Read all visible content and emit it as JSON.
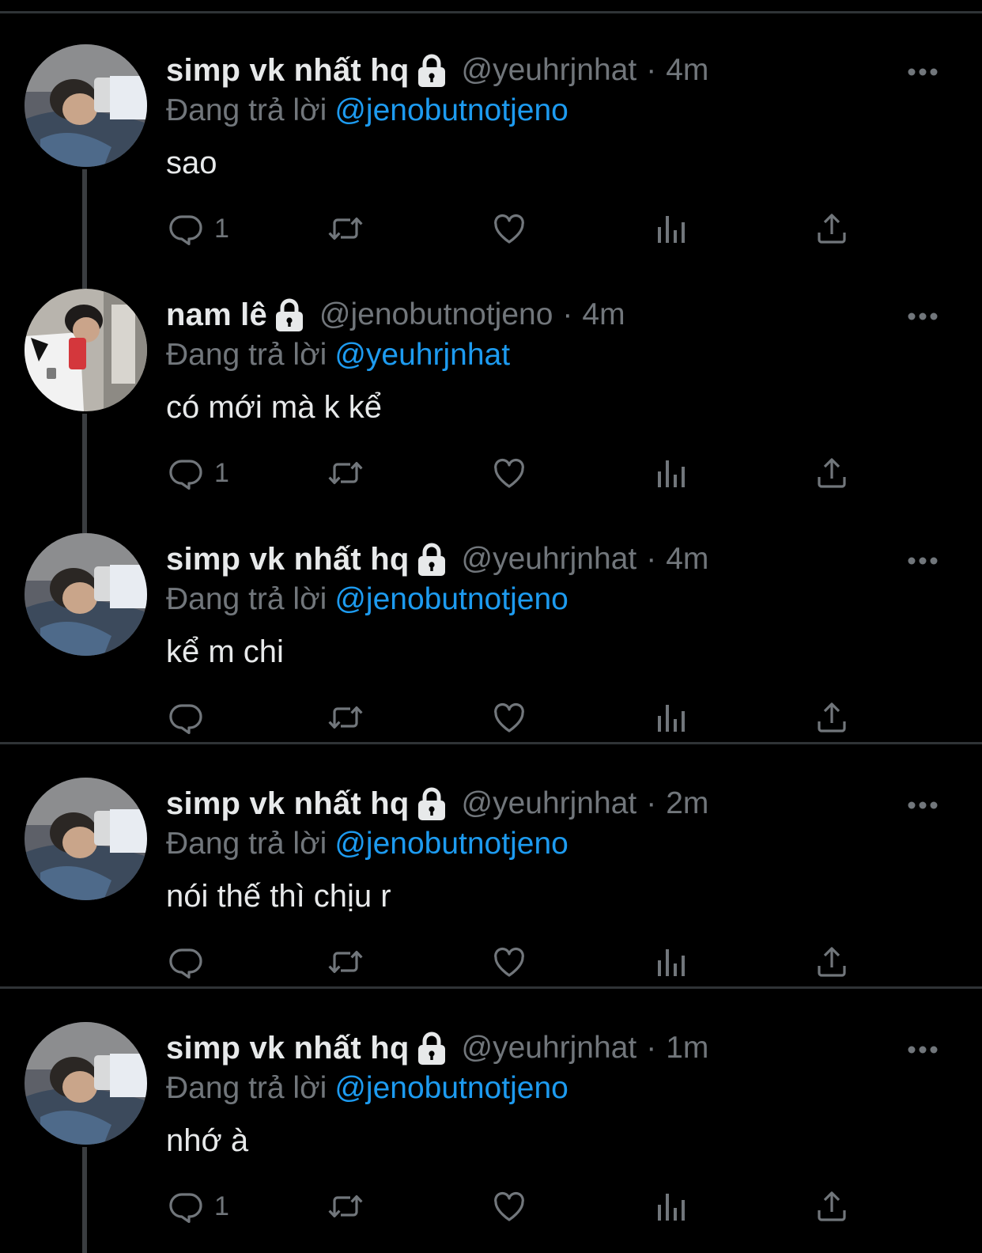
{
  "replying_prefix": "Đang trả lời",
  "dot": "·",
  "tweets": [
    {
      "name": "simp vk nhất hq",
      "handle": "@yeuhrjnhat",
      "time": "4m",
      "replying_to": "@jenobutnotjeno",
      "text": "sao",
      "reply_count": "1"
    },
    {
      "name": "nam lê",
      "handle": "@jenobutnotjeno",
      "time": "4m",
      "replying_to": "@yeuhrjnhat",
      "text": "có mới mà k kể",
      "reply_count": "1"
    },
    {
      "name": "simp vk nhất hq",
      "handle": "@yeuhrjnhat",
      "time": "4m",
      "replying_to": "@jenobutnotjeno",
      "text": "kể m chi",
      "reply_count": ""
    },
    {
      "name": "simp vk nhất hq",
      "handle": "@yeuhrjnhat",
      "time": "2m",
      "replying_to": "@jenobutnotjeno",
      "text": "nói thế thì chịu r",
      "reply_count": ""
    },
    {
      "name": "simp vk nhất hq",
      "handle": "@yeuhrjnhat",
      "time": "1m",
      "replying_to": "@jenobutnotjeno",
      "text": "nhớ à",
      "reply_count": "1"
    }
  ],
  "colors": {
    "background": "#000000",
    "primary_text": "#e7e9ea",
    "secondary_text": "#71767b",
    "mention": "#1d9bf0",
    "divider": "#2f3336"
  },
  "icons": [
    "lock-icon",
    "more-icon",
    "reply-icon",
    "retweet-icon",
    "like-icon",
    "views-icon",
    "share-icon"
  ]
}
